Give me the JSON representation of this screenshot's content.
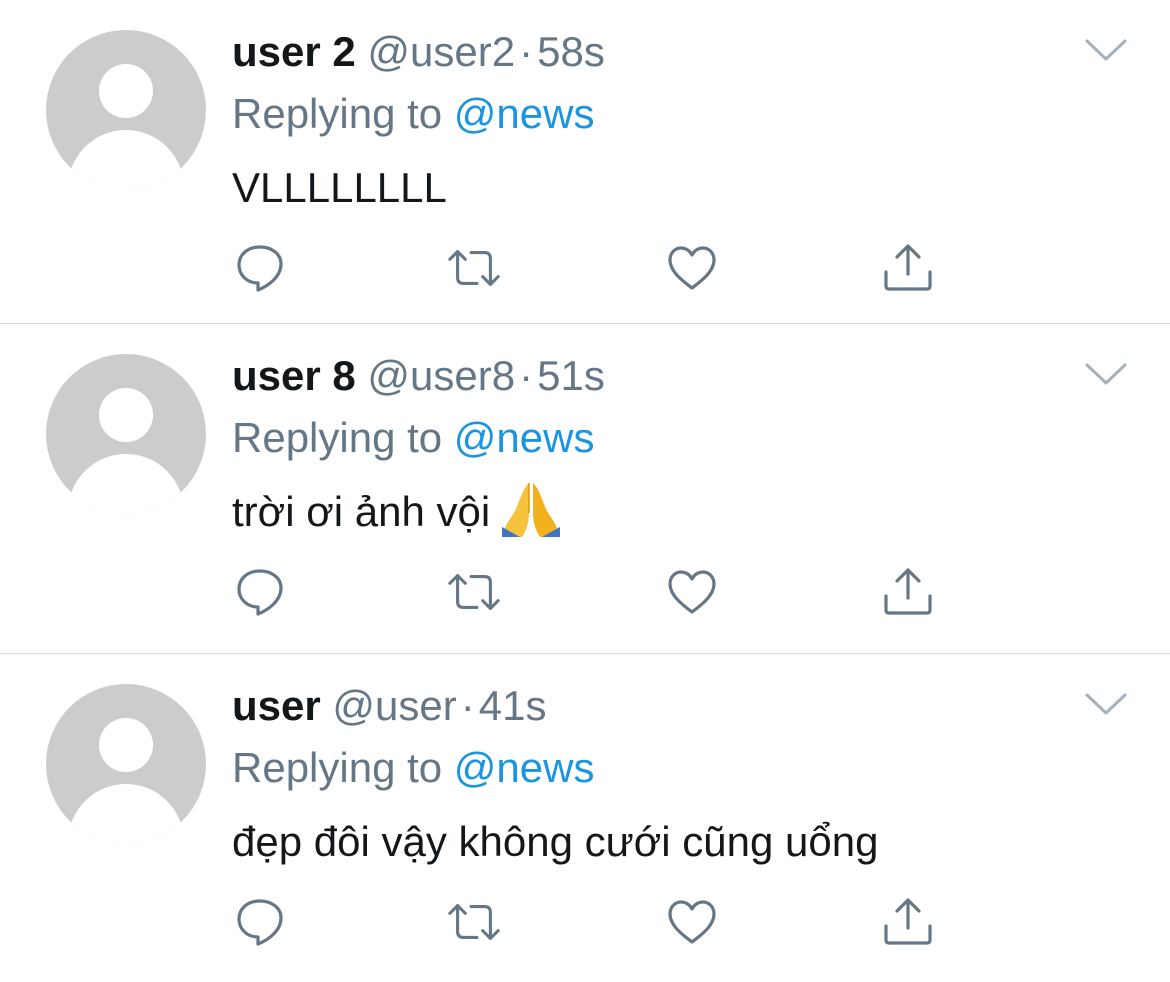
{
  "reply_prefix": "Replying to",
  "colors": {
    "name": "#14171a",
    "secondary": "#657786",
    "mention": "#1b95e0",
    "avatar": "#cccccc",
    "divider": "#d6dbe0"
  },
  "icons": {
    "reply": "speech-bubble-icon",
    "retweet": "retweet-arrows-icon",
    "like": "heart-icon",
    "share": "share-upload-icon",
    "menu": "chevron-down-icon",
    "avatar": "default-avatar-icon"
  },
  "tweets": [
    {
      "display_name": "user 2",
      "handle": "@user2",
      "separator": "·",
      "time": "58s",
      "reply_to": "@news",
      "text": "VLLLLLLLL",
      "emoji": ""
    },
    {
      "display_name": "user 8",
      "handle": "@user8",
      "separator": "·",
      "time": "51s",
      "reply_to": "@news",
      "text": "trời ơi ảnh vội",
      "emoji": "folded-hands"
    },
    {
      "display_name": "user",
      "handle": "@user",
      "separator": "·",
      "time": "41s",
      "reply_to": "@news",
      "text": "đẹp đôi vậy không cưới cũng uổng",
      "emoji": ""
    }
  ]
}
